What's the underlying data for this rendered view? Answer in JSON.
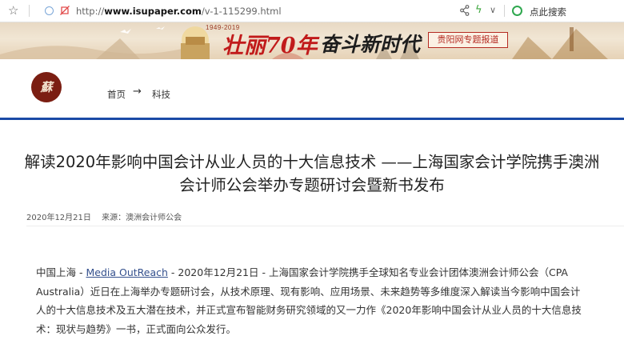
{
  "browser": {
    "url_prefix": "http://",
    "url_domain": "www.isupaper.com",
    "url_path": "/v-1-115299.html",
    "search_label": "点此搜索",
    "icons": [
      "star-icon",
      "globe-icon",
      "no-tracking-icon",
      "share-icon",
      "lightning-icon",
      "chevron-down-icon",
      "search-icon"
    ]
  },
  "banner": {
    "years": "1949-2019",
    "slogan_1": "壮丽70年",
    "slogan_2": "奋斗新时代",
    "tag": "贵阳网专题报道",
    "colors": {
      "red": "#c11b1b",
      "gold": "#d4a64a"
    }
  },
  "site": {
    "logo_char": "蘇",
    "breadcrumb": {
      "home": "首页",
      "arrow": "→",
      "section": "科技"
    },
    "accent": "#1a4aa6"
  },
  "article": {
    "title_line1": "解读2020年影响中国会计从业人员的十大信息技术 ——上海国家会计学院携手澳洲",
    "title_line2": "会计师公会举办专题研讨会暨新书发布",
    "date": "2020年12月21日",
    "source": "来源：澳洲会计师公会",
    "para_prefix": "中国上海 - ",
    "para_link": "Media OutReach",
    "para_body": " - 2020年12月21日 - 上海国家会计学院携手全球知名专业会计团体澳洲会计师公会（CPA Australia）近日在上海举办专题研讨会，从技术原理、现有影响、应用场景、未来趋势等多维度深入解读当今影响中国会计人的十大信息技术及五大潜在技术，并正式宣布智能财务研究领域的又一力作《2020年影响中国会计从业人员的十大信息技术：现状与趋势》一书，正式面向公众发行。"
  }
}
